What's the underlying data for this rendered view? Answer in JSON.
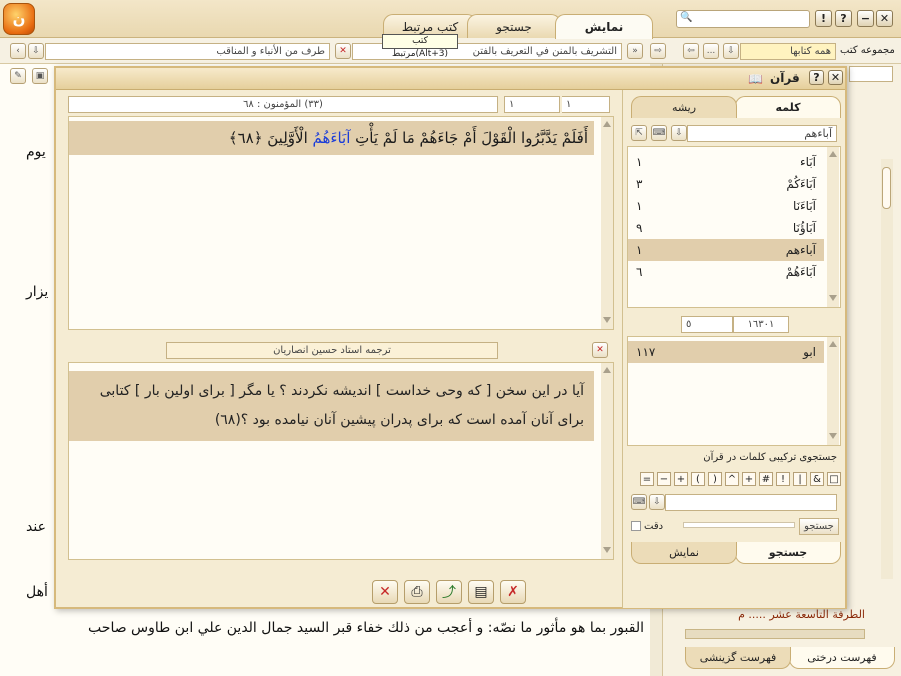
{
  "tabs": {
    "display": "نمایش",
    "search": "جستجو",
    "related_books": "کتب مرتبط"
  },
  "tooltip": "کتب مرتبط(Alt+3)",
  "toolbar2": {
    "book_group_label": "مجموعه کتب",
    "book_group_value": "همه کتابها",
    "current_book": "التشريف بالمنن في التعريف بالفتن",
    "section": "طرف من الأنباء و المناقب",
    "more": "..."
  },
  "background_doc": {
    "line1": "يوم",
    "line2": "يزار",
    "line3": "عند",
    "line4": "أهل",
    "line5": "القبور بما هو مأثور ما نصّه: و أعجب من ذلك خفاء قبر السيد جمال الدين علي ابن طاوس صاحب"
  },
  "sidebar": {
    "link_text": "الطرفة التاسعة عشر ..... م",
    "tab_tree": "فهرست درختی",
    "tab_linear": "فهرست گزینشی"
  },
  "quran_window": {
    "title": "قرآن",
    "verse_ref": "(٣٣) المؤمنون : ٦٨",
    "page_a": "١",
    "page_b": "١",
    "verse_text_part1": "أَفَلَمْ يَدَّبَّرُوا الْقَوْلَ أَمْ جَاءَهُمْ مَا لَمْ يَأْتِ",
    "verse_text_highlight": "آبَاءَهُمُ",
    "verse_text_part2": "الْأَوَّلِينَ ﴿٦٨﴾",
    "translator": "ترجمه استاد حسين انصاريان",
    "translation": "آیا در این سخن [ که وحی خداست ] اندیشه نکردند ؟ یا مگر [ برای اولین بار ] کتابی برای آنان آمده است که برای پدران پیشین آنان نیامده بود ؟(٦٨)",
    "word_tab": "كلمه",
    "root_tab": "ريشه",
    "word_input": "آباءهم",
    "words": [
      {
        "word": "آبَاء",
        "count": "١"
      },
      {
        "word": "آبَاءَكُمْ",
        "count": "٣"
      },
      {
        "word": "آبَاءَنَا",
        "count": "١"
      },
      {
        "word": "آبَاؤُنَا",
        "count": "٩"
      },
      {
        "word": "آباءهم",
        "count": "١"
      },
      {
        "word": "آبَاءَهُمْ",
        "count": "٦"
      }
    ],
    "counter_total": "١٦٣٠١",
    "counter_current": "٥",
    "root_word": "ابو",
    "root_count": "١١٧",
    "combo_search_label": "جستجوی ترکیبی کلمات در قرآن",
    "operators": [
      "□",
      "&",
      "|",
      "!",
      "#",
      "+",
      "^",
      ")",
      "(",
      "+",
      "−",
      "="
    ],
    "search_button": "جستجو",
    "precision_label": "دقت",
    "bottom_tab_display": "نمایش",
    "bottom_tab_search": "جستجو"
  },
  "colors": {
    "accent": "#e1ceac",
    "highlight_word": "#1a3cd8",
    "close_red": "#c62828",
    "verse_red": "#8b1a1a"
  }
}
